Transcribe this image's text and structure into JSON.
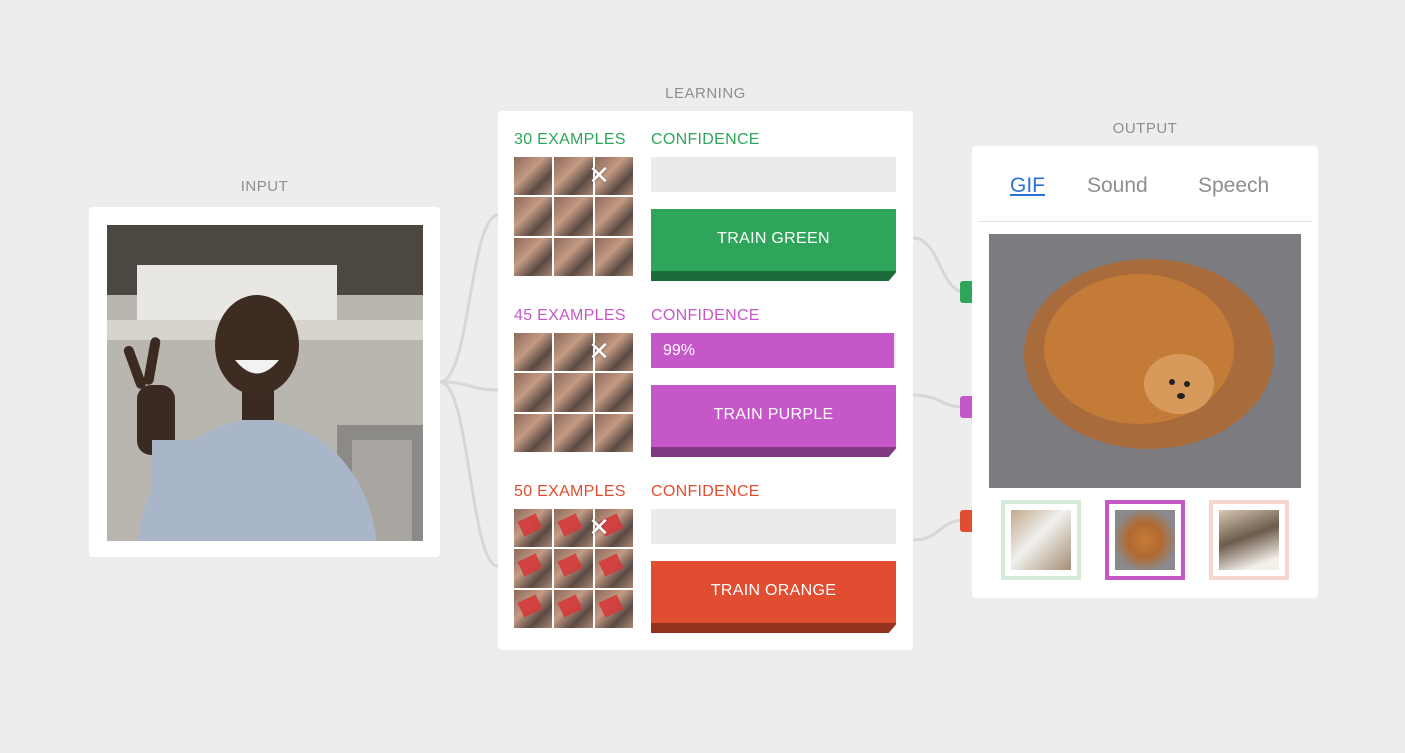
{
  "sections": {
    "input_title": "INPUT",
    "learning_title": "LEARNING",
    "output_title": "OUTPUT"
  },
  "colors": {
    "green": "#2ea55a",
    "purple": "#c657c9",
    "orange": "#e04d30",
    "link_blue": "#2f6fd8"
  },
  "learning": {
    "classes": [
      {
        "examples_label": "30 EXAMPLES",
        "confidence_label": "CONFIDENCE",
        "confidence_value": "",
        "confidence_fraction": 0,
        "train_label": "TRAIN GREEN",
        "color": "#2ea55a"
      },
      {
        "examples_label": "45 EXAMPLES",
        "confidence_label": "CONFIDENCE",
        "confidence_value": "99%",
        "confidence_fraction": 0.99,
        "train_label": "TRAIN PURPLE",
        "color": "#c657c9"
      },
      {
        "examples_label": "50 EXAMPLES",
        "confidence_label": "CONFIDENCE",
        "confidence_value": "",
        "confidence_fraction": 0,
        "train_label": "TRAIN ORANGE",
        "color": "#e04d30"
      }
    ],
    "delete_icon": "close-icon"
  },
  "output": {
    "tabs": [
      {
        "label": "GIF",
        "active": true
      },
      {
        "label": "Sound",
        "active": false
      },
      {
        "label": "Speech",
        "active": false
      }
    ]
  }
}
